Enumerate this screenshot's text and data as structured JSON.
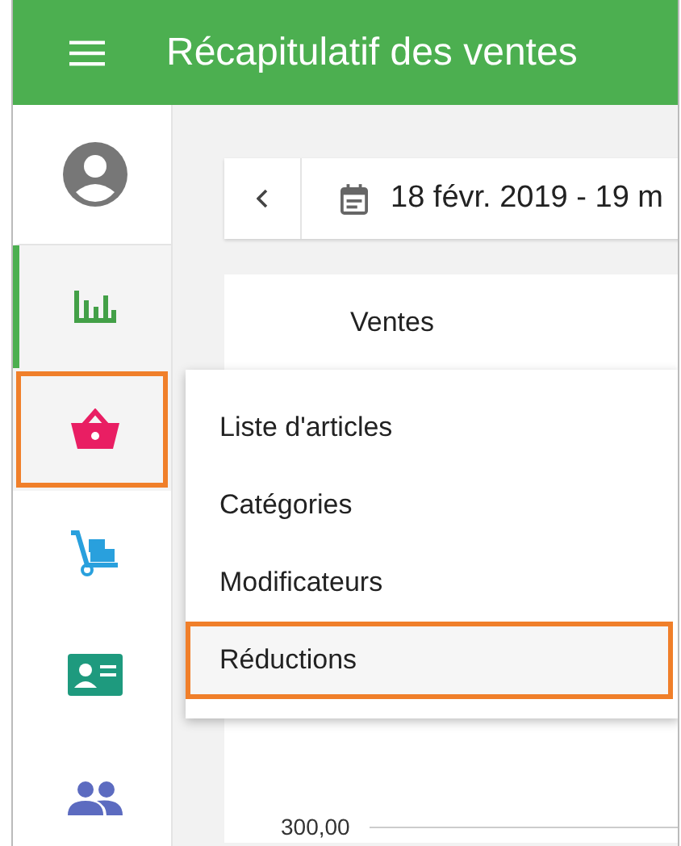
{
  "header": {
    "title": "Récapitulatif des ventes"
  },
  "sidebar": {
    "items": [
      {
        "kind": "avatar",
        "selected": false,
        "highlighted": false
      },
      {
        "kind": "chart",
        "selected": true,
        "highlighted": false
      },
      {
        "kind": "basket",
        "selected": false,
        "highlighted": true
      },
      {
        "kind": "dolly",
        "selected": false,
        "highlighted": false
      },
      {
        "kind": "card",
        "selected": false,
        "highlighted": false
      },
      {
        "kind": "people",
        "selected": false,
        "highlighted": false
      }
    ]
  },
  "date_bar": {
    "range": "18 févr. 2019 - 19 m"
  },
  "report": {
    "tab": "Ventes",
    "y_tick": "300,00"
  },
  "menu": {
    "items": [
      {
        "label": "Liste d'articles",
        "highlighted": false
      },
      {
        "label": "Catégories",
        "highlighted": false
      },
      {
        "label": "Modificateurs",
        "highlighted": false
      },
      {
        "label": "Réductions",
        "highlighted": true
      }
    ]
  }
}
